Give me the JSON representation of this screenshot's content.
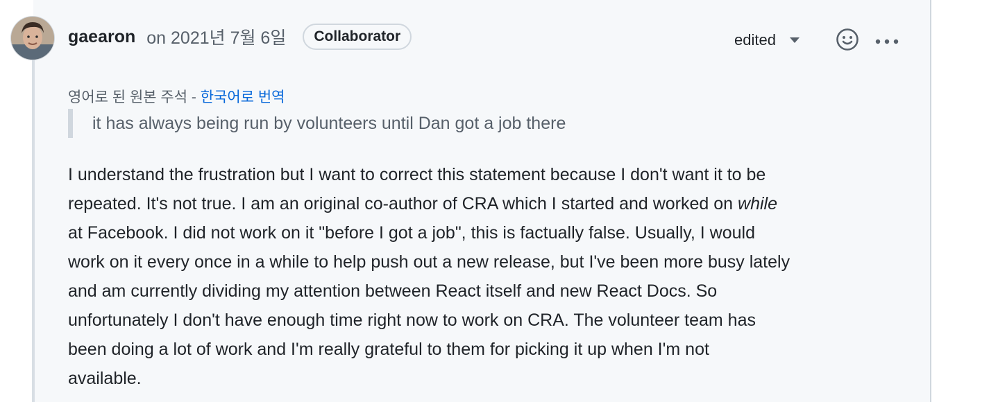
{
  "comment": {
    "author": "gaearon",
    "timestamp": "on 2021년 7월 6일",
    "role_badge": "Collaborator",
    "edited_label": "edited",
    "emoji_icon": "smiley-icon",
    "more_icon": "kebab-horizontal-icon",
    "translation": {
      "original_label": "영어로 된 원본 주석 - ",
      "translate_link": "한국어로 번역"
    },
    "quote": "it has always being run by volunteers until Dan got a job there",
    "body": {
      "line1": "I understand the frustration but I want to correct this statement because I don't want it to be",
      "line2_a": "repeated. It's not true. I am an original co-author of CRA which I started and worked on ",
      "line2_em": "while",
      "line3": "at Facebook. I did not work on it \"before I got a job\", this is factually false. Usually, I would",
      "line4": "work on it every once in a while to help push out a new release, but I've been more busy lately",
      "line5": "and am currently dividing my attention between React itself and new React Docs. So",
      "line6": "unfortunately I don't have enough time right now to work on CRA. The volunteer team has",
      "line7": "been doing a lot of work and I'm really grateful to them for picking it up when I'm not",
      "line8": "available."
    }
  },
  "colors": {
    "link": "#0969da",
    "muted": "#57606a",
    "text": "#1f2328",
    "background": "#f6f8fa",
    "border": "#d0d7de"
  }
}
